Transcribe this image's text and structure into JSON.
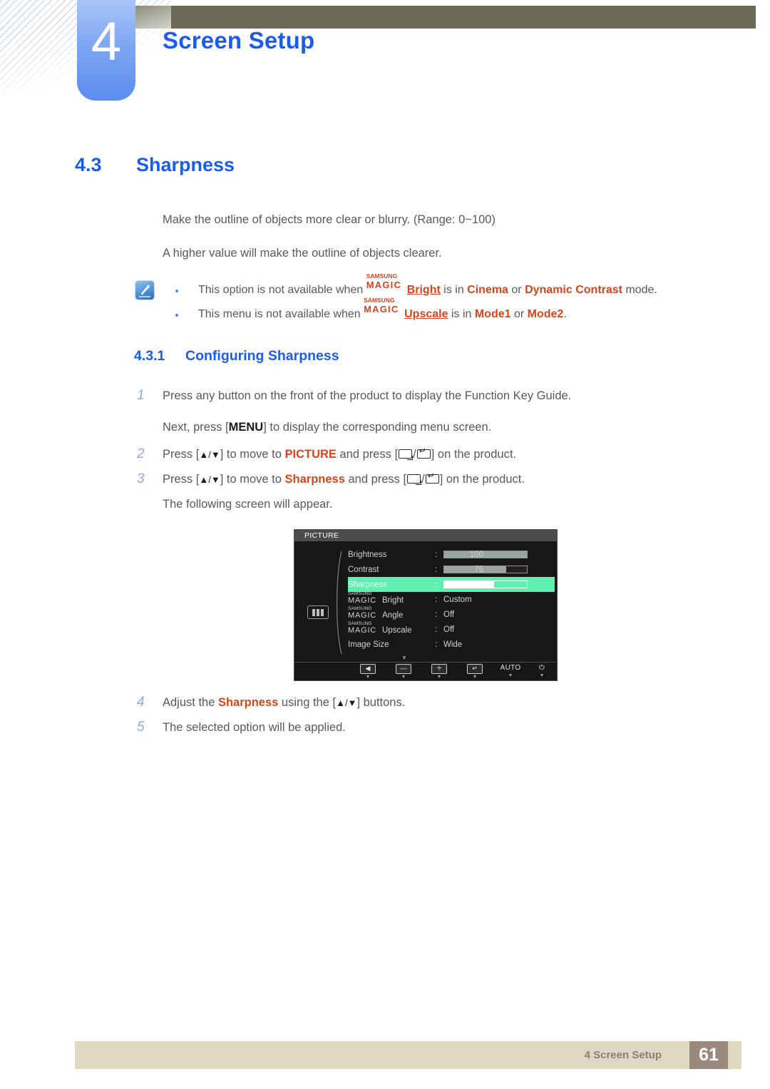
{
  "chapter": {
    "number": "4",
    "title": "Screen Setup"
  },
  "section": {
    "number": "4.3",
    "title": "Sharpness",
    "paragraph_1": "Make the outline of objects more clear or blurry. (Range: 0~100)",
    "paragraph_2": "A higher value will make the outline of objects clearer."
  },
  "note": {
    "icon": "note-pen-icon",
    "bullets": [
      {
        "lead": "This option is not available when ",
        "magic_sub": "SAMSUNG",
        "magic_main": "MAGIC",
        "feature": "Bright",
        "mid": " is in ",
        "value_1": "Cinema",
        "conj": " or ",
        "value_2": "Dynamic Contrast",
        "tail": " mode."
      },
      {
        "lead": "This menu is not available when ",
        "magic_sub": "SAMSUNG",
        "magic_main": "MAGIC",
        "feature": "Upscale",
        "mid": " is in ",
        "value_1": "Mode1",
        "conj": " or ",
        "value_2": "Mode2",
        "tail": "."
      }
    ]
  },
  "subsection": {
    "number": "4.3.1",
    "title": "Configuring Sharpness",
    "steps": [
      {
        "n": "1",
        "text": "Press any button on the front of the product to display the Function Key Guide.",
        "sub_pre": "Next, press [",
        "sub_key": "MENU",
        "sub_post": "] to display the corresponding menu screen."
      },
      {
        "n": "2",
        "pre": "Press [",
        "keys": "▲/▼",
        "mid": "] to move to ",
        "target": "PICTURE",
        "mid2": " and press [",
        "post": "] on the product."
      },
      {
        "n": "3",
        "pre": "Press [",
        "keys": "▲/▼",
        "mid": "] to move to ",
        "target": "Sharpness",
        "mid2": " and press [",
        "post": "] on the product.",
        "sub": "The following screen will appear."
      },
      {
        "n": "4",
        "pre": "Adjust the ",
        "target": "Sharpness",
        "mid": " using the [",
        "keys": "▲/▼",
        "post": "] buttons."
      },
      {
        "n": "5",
        "text": "The selected option will be applied."
      }
    ]
  },
  "osd": {
    "title": "PICTURE",
    "side_icon": "picture-mode-icon",
    "rows": [
      {
        "label": "Brightness",
        "type": "bar",
        "value": "100",
        "fill": 100,
        "selected": false
      },
      {
        "label": "Contrast",
        "type": "bar",
        "value": "75",
        "fill": 75,
        "selected": false
      },
      {
        "label": "Sharpness",
        "type": "bar",
        "value": "60",
        "fill": 60,
        "selected": true
      },
      {
        "label_magic_sub": "SAMSUNG",
        "label_magic_main": "MAGIC",
        "label": "Bright",
        "type": "text",
        "value": "Custom",
        "selected": false
      },
      {
        "label_magic_sub": "SAMSUNG",
        "label_magic_main": "MAGIC",
        "label": "Angle",
        "type": "text",
        "value": "Off",
        "selected": false
      },
      {
        "label_magic_sub": "SAMSUNG",
        "label_magic_main": "MAGIC",
        "label": "Upscale",
        "type": "text",
        "value": "Off",
        "selected": false
      },
      {
        "label": "Image Size",
        "type": "text",
        "value": "Wide",
        "selected": false
      }
    ],
    "scroll_down": "▼",
    "footer_buttons": [
      {
        "icon": "back-arrow-icon",
        "glyph": "◀",
        "kind": "icon",
        "down": "▼"
      },
      {
        "icon": "minus-icon",
        "glyph": "—",
        "kind": "icon",
        "down": "▼"
      },
      {
        "icon": "plus-icon",
        "glyph": "＋",
        "kind": "icon",
        "down": "▼"
      },
      {
        "icon": "enter-icon",
        "glyph": "↵",
        "kind": "icon",
        "down": "▼"
      },
      {
        "icon": "auto-button",
        "glyph": "AUTO",
        "kind": "text",
        "down": "▼"
      },
      {
        "icon": "power-icon",
        "glyph": "⏻",
        "kind": "text",
        "down": "▼"
      }
    ]
  },
  "footer": {
    "text": "4 Screen Setup",
    "page": "61"
  },
  "colors": {
    "heading_blue": "#1a5cf0",
    "accent_orange": "#d9451b",
    "osd_highlight": "#5df0ae",
    "topbar": "#6c6a55",
    "footer_bar": "#ded8c3",
    "page_badge": "#9a8a7d"
  }
}
